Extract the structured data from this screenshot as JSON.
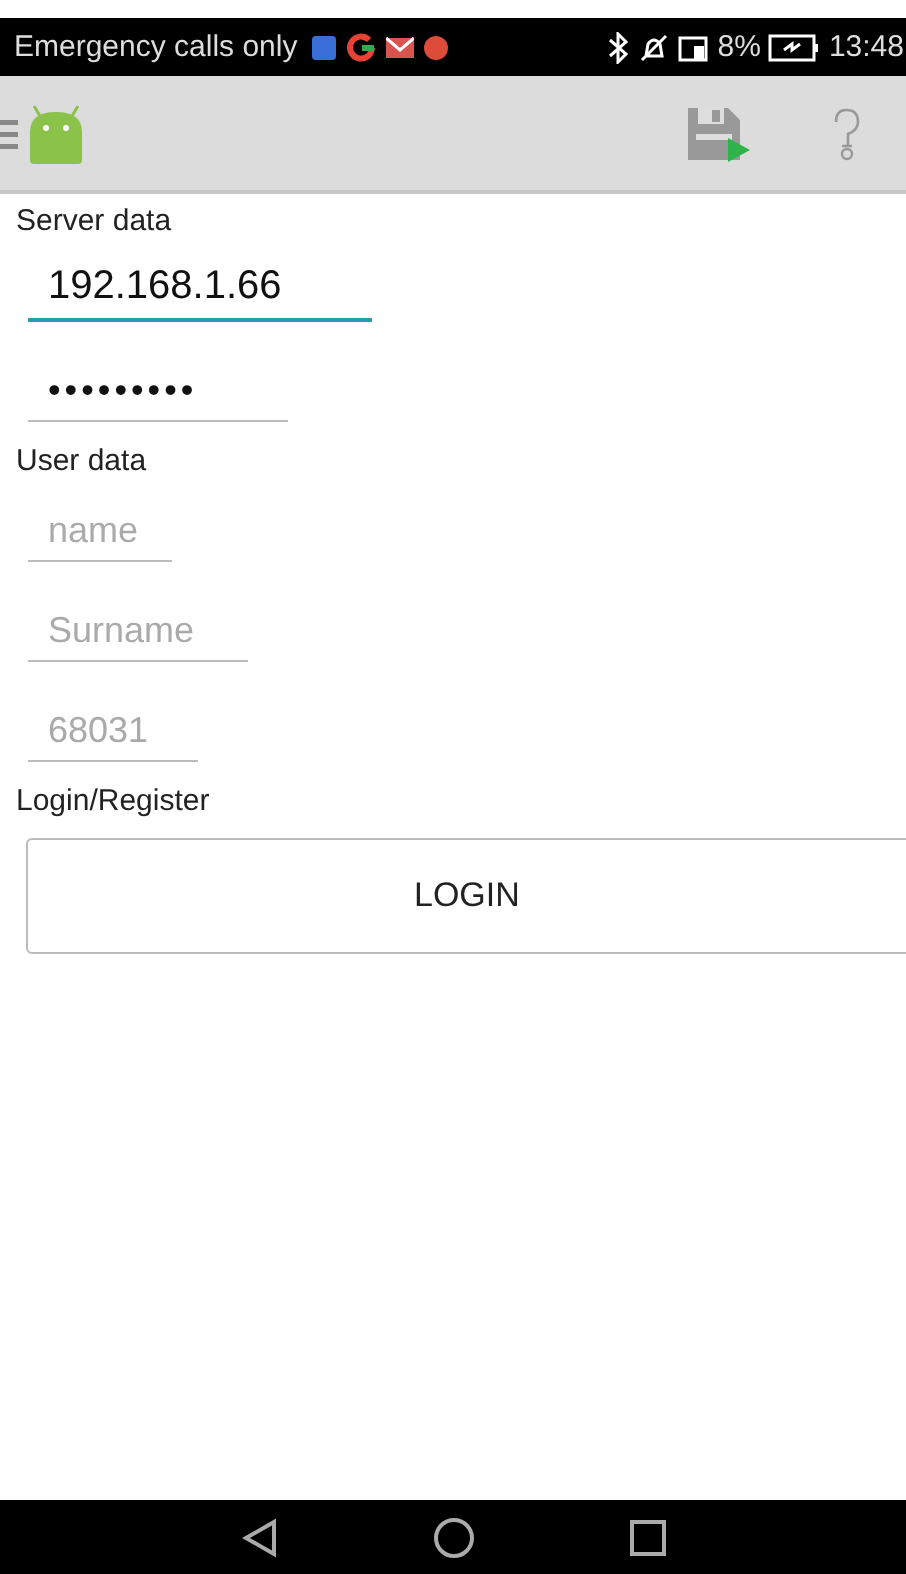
{
  "status_bar": {
    "carrier": "Emergency calls only",
    "battery_percent": "8%",
    "time": "13:48"
  },
  "sections": [
    {
      "title": "Server data",
      "fields": [
        {
          "kind": "text",
          "value": "192.168.1.66",
          "focused": true
        },
        {
          "kind": "password",
          "value": "•••••••••",
          "focused": false
        }
      ]
    },
    {
      "title": "User data",
      "fields": [
        {
          "kind": "text",
          "placeholder": "name",
          "focused": false
        },
        {
          "kind": "text",
          "placeholder": "Surname",
          "focused": false
        },
        {
          "kind": "text",
          "placeholder": "68031",
          "focused": false
        }
      ]
    },
    {
      "title": "Login/Register",
      "button": "LOGIN"
    }
  ]
}
